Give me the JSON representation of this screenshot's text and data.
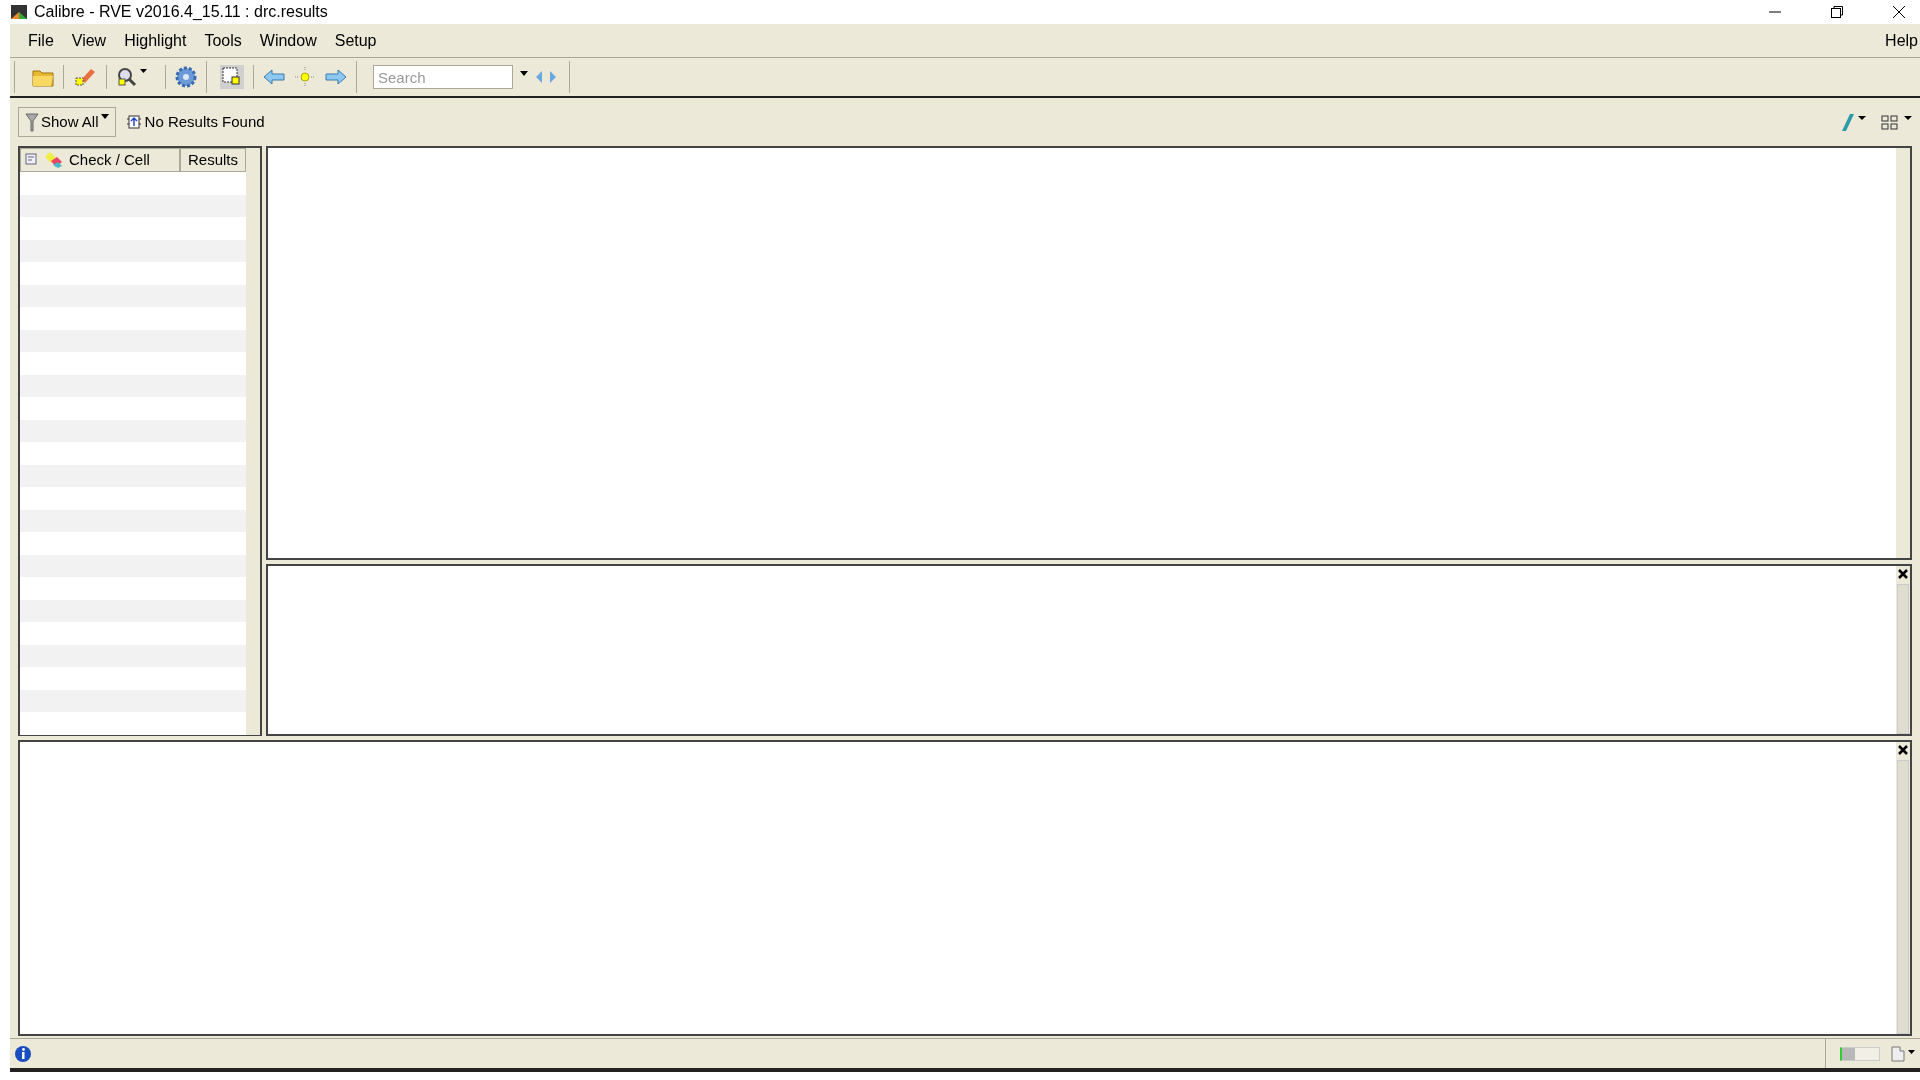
{
  "window": {
    "title": "Calibre - RVE v2016.4_15.11 : drc.results"
  },
  "menu": [
    {
      "label": "File"
    },
    {
      "label": "View"
    },
    {
      "label": "Highlight"
    },
    {
      "label": "Tools"
    },
    {
      "label": "Window"
    },
    {
      "label": "Setup"
    }
  ],
  "help_menu": {
    "label": "Help"
  },
  "toolbar": {
    "search": {
      "placeholder": "Search"
    }
  },
  "filter_bar": {
    "filter_button": "Show All",
    "status": "No Results Found"
  },
  "results_tree": {
    "columns": [
      {
        "label": "Check / Cell"
      },
      {
        "label": "Results"
      }
    ]
  },
  "status_bar": {
    "memory_meter": {
      "level": 0.35
    }
  }
}
